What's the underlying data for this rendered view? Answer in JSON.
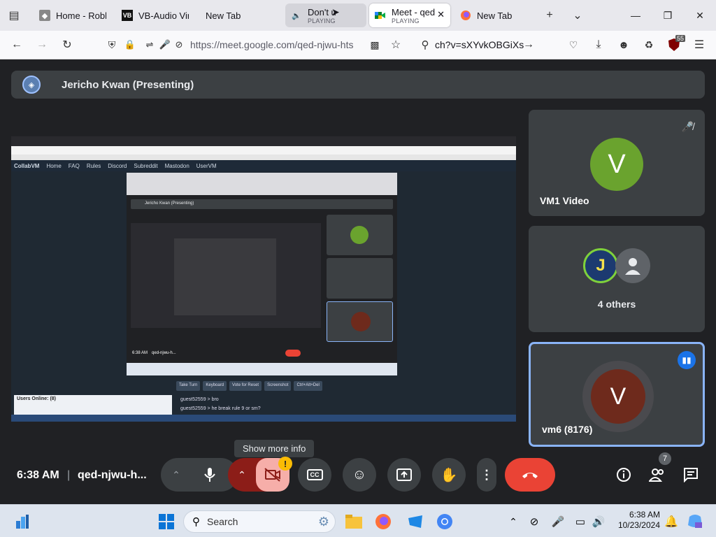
{
  "tabs": [
    {
      "label": "Home - Roblo",
      "icon": "roblox-icon"
    },
    {
      "label": "VB-Audio Virti",
      "icon": "vb-icon"
    },
    {
      "label": "New Tab",
      "icon": ""
    },
    {
      "label": "Don't u",
      "sub": "PLAYING",
      "icon": "speaker-icon"
    },
    {
      "label": "Meet - qed",
      "sub": "PLAYING",
      "icon": "meet-icon"
    },
    {
      "label": "New Tab",
      "icon": "firefox-icon"
    }
  ],
  "addressbar": {
    "url": "https://meet.google.com/qed-njwu-hts",
    "search": "ch?v=sXYvkOBGiXs"
  },
  "extension_badge": "55",
  "meet": {
    "presenter_banner": "Jericho Kwan (Presenting)",
    "tiles": [
      {
        "name": "VM1 Video",
        "initial": "V",
        "color": "#6aa32e"
      },
      {
        "name": "4 others"
      },
      {
        "name": "vm6 (8176)",
        "initial": "V",
        "color": "#6e2a1c"
      }
    ],
    "time": "6:38 AM",
    "separator": "|",
    "meeting_code": "qed-njwu-h...",
    "tooltip": "Show more info",
    "warning": "!",
    "participants_count": "7",
    "end_call_color": "#ea4335"
  },
  "shared_screen": {
    "title": "CollabVM",
    "nav": [
      "Home",
      "FAQ",
      "Rules",
      "Discord",
      "Subreddit",
      "Mastodon",
      "UserVM"
    ],
    "banner": "Jericho Kwan (Presenting)",
    "users_online": "Users Online: (8)",
    "vm_buttons": [
      "Take Turn",
      "Keyboard",
      "Vote for Reset",
      "Screenshot",
      "Ctrl+Alt+Del"
    ],
    "chat": [
      "guest52559 > bro",
      "guest52559 > he break rule 9 or sm?"
    ],
    "inner_time": "6:38 AM",
    "inner_code": "qed-njwu-h..."
  },
  "taskbar": {
    "search": "Search",
    "time": "6:38 AM",
    "date": "10/23/2024"
  }
}
